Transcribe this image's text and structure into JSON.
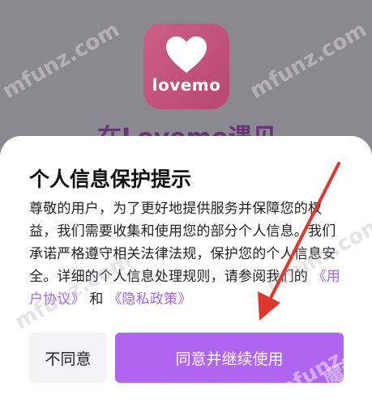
{
  "app_logo": {
    "text": "lovemo",
    "icon": "heart-icon"
  },
  "background_title": "在Lovemo遇见",
  "dialog": {
    "title": "个人信息保护提示",
    "body_text": "尊敬的用户，为了更好地提供服务并保障您的权益，我们需要收集和使用您的部分个人信息。我们承诺严格遵守相关法律法规，保护您的个人信息安全。详细的个人信息处理规则，请参阅我们的",
    "link_user_agreement": "《用户协议》",
    "and_text": "和",
    "link_privacy_policy": "《隐私政策》",
    "disagree_label": "不同意",
    "agree_label": "同意并继续使用"
  },
  "watermarks": [
    "mfunz.com",
    "mfunz.com",
    "mfunz.com",
    "mfunz.com",
    "mfunz.com",
    "魔趣网"
  ],
  "colors": {
    "accent": "#b065f0",
    "link": "#9f6ad8",
    "overlay": "#8a8891",
    "arrow": "#e0362c"
  }
}
